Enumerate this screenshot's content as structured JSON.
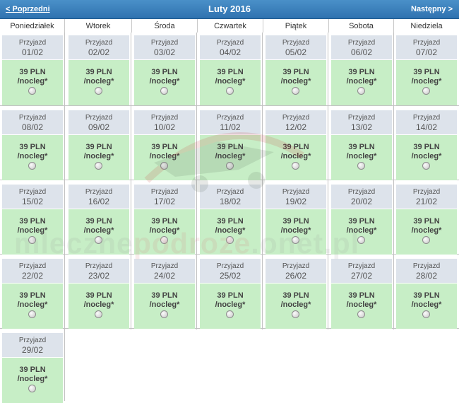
{
  "header": {
    "prev_label": "< Poprzedni",
    "title": "Luty 2016",
    "next_label": "Następny >",
    "background_color": "#3a80bd"
  },
  "weekdays": [
    "Poniedziałek",
    "Wtorek",
    "Środa",
    "Czwartek",
    "Piątek",
    "Sobota",
    "Niedziela"
  ],
  "days": [
    {
      "arrive": "Przyjazd",
      "date": "01/02",
      "price": "39 PLN",
      "per_night": "/nocleg*"
    },
    {
      "arrive": "Przyjazd",
      "date": "02/02",
      "price": "39 PLN",
      "per_night": "/nocleg*"
    },
    {
      "arrive": "Przyjazd",
      "date": "03/02",
      "price": "39 PLN",
      "per_night": "/nocleg*"
    },
    {
      "arrive": "Przyjazd",
      "date": "04/02",
      "price": "39 PLN",
      "per_night": "/nocleg*"
    },
    {
      "arrive": "Przyjazd",
      "date": "05/02",
      "price": "39 PLN",
      "per_night": "/nocleg*"
    },
    {
      "arrive": "Przyjazd",
      "date": "06/02",
      "price": "39 PLN",
      "per_night": "/nocleg*"
    },
    {
      "arrive": "Przyjazd",
      "date": "07/02",
      "price": "39 PLN",
      "per_night": "/nocleg*"
    },
    {
      "arrive": "Przyjazd",
      "date": "08/02",
      "price": "39 PLN",
      "per_night": "/nocleg*"
    },
    {
      "arrive": "Przyjazd",
      "date": "09/02",
      "price": "39 PLN",
      "per_night": "/nocleg*"
    },
    {
      "arrive": "Przyjazd",
      "date": "10/02",
      "price": "39 PLN",
      "per_night": "/nocleg*"
    },
    {
      "arrive": "Przyjazd",
      "date": "11/02",
      "price": "39 PLN",
      "per_night": "/nocleg*"
    },
    {
      "arrive": "Przyjazd",
      "date": "12/02",
      "price": "39 PLN",
      "per_night": "/nocleg*"
    },
    {
      "arrive": "Przyjazd",
      "date": "13/02",
      "price": "39 PLN",
      "per_night": "/nocleg*"
    },
    {
      "arrive": "Przyjazd",
      "date": "14/02",
      "price": "39 PLN",
      "per_night": "/nocleg*"
    },
    {
      "arrive": "Przyjazd",
      "date": "15/02",
      "price": "39 PLN",
      "per_night": "/nocleg*"
    },
    {
      "arrive": "Przyjazd",
      "date": "16/02",
      "price": "39 PLN",
      "per_night": "/nocleg*"
    },
    {
      "arrive": "Przyjazd",
      "date": "17/02",
      "price": "39 PLN",
      "per_night": "/nocleg*"
    },
    {
      "arrive": "Przyjazd",
      "date": "18/02",
      "price": "39 PLN",
      "per_night": "/nocleg*"
    },
    {
      "arrive": "Przyjazd",
      "date": "19/02",
      "price": "39 PLN",
      "per_night": "/nocleg*"
    },
    {
      "arrive": "Przyjazd",
      "date": "20/02",
      "price": "39 PLN",
      "per_night": "/nocleg*"
    },
    {
      "arrive": "Przyjazd",
      "date": "21/02",
      "price": "39 PLN",
      "per_night": "/nocleg*"
    },
    {
      "arrive": "Przyjazd",
      "date": "22/02",
      "price": "39 PLN",
      "per_night": "/nocleg*"
    },
    {
      "arrive": "Przyjazd",
      "date": "23/02",
      "price": "39 PLN",
      "per_night": "/nocleg*"
    },
    {
      "arrive": "Przyjazd",
      "date": "24/02",
      "price": "39 PLN",
      "per_night": "/nocleg*"
    },
    {
      "arrive": "Przyjazd",
      "date": "25/02",
      "price": "39 PLN",
      "per_night": "/nocleg*"
    },
    {
      "arrive": "Przyjazd",
      "date": "26/02",
      "price": "39 PLN",
      "per_night": "/nocleg*"
    },
    {
      "arrive": "Przyjazd",
      "date": "27/02",
      "price": "39 PLN",
      "per_night": "/nocleg*"
    },
    {
      "arrive": "Przyjazd",
      "date": "28/02",
      "price": "39 PLN",
      "per_night": "/nocleg*"
    },
    {
      "arrive": "Przyjazd",
      "date": "29/02",
      "price": "39 PLN",
      "per_night": "/nocleg*"
    }
  ],
  "colors": {
    "date_header_bg": "#dde3eb",
    "price_area_bg": "#c7eec6",
    "grid_line": "#c2c2c2"
  },
  "watermark": {
    "part1": "mleczne",
    "part2": "podroze",
    "part3": ".onet.pl"
  }
}
